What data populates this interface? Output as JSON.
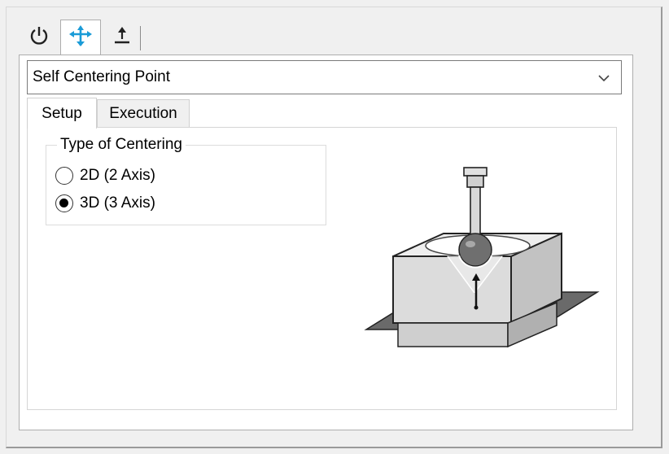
{
  "top_tabs": [
    {
      "icon": "power-icon",
      "selected": false
    },
    {
      "icon": "move-probe-icon",
      "selected": true,
      "color": "#1a9bd7"
    },
    {
      "icon": "upload-icon",
      "selected": false
    }
  ],
  "method_select": {
    "value": "Self Centering Point"
  },
  "inner_tabs": {
    "setup": "Setup",
    "execution": "Execution",
    "selected": "setup"
  },
  "centering": {
    "legend": "Type of Centering",
    "options": [
      {
        "label": "2D (2 Axis)",
        "checked": false
      },
      {
        "label": "3D (3 Axis)",
        "checked": true
      }
    ]
  },
  "illustration": {
    "name": "self-centering-3d-probe-diagram"
  }
}
